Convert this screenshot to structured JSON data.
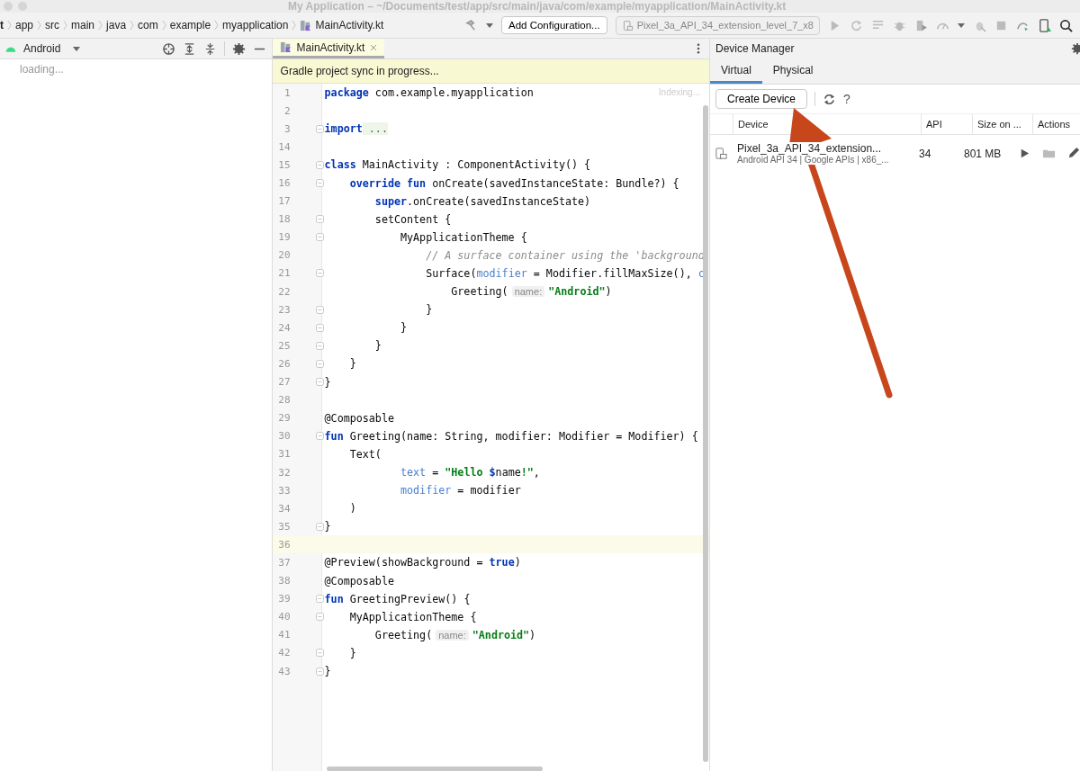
{
  "window": {
    "title": "My Application – ~/Documents/test/app/src/main/java/com/example/myapplication/MainActivity.kt"
  },
  "breadcrumbs": [
    {
      "label": "t",
      "kind": "folder"
    },
    {
      "label": "app",
      "kind": "folder"
    },
    {
      "label": "src",
      "kind": "folder"
    },
    {
      "label": "main",
      "kind": "folder"
    },
    {
      "label": "java",
      "kind": "folder"
    },
    {
      "label": "com",
      "kind": "folder"
    },
    {
      "label": "example",
      "kind": "folder"
    },
    {
      "label": "myapplication",
      "kind": "folder"
    },
    {
      "label": "MainActivity.kt",
      "kind": "file"
    }
  ],
  "toolbar": {
    "config_button": "Add Configuration...",
    "device_selector": "Pixel_3a_API_34_extension_level_7_x8"
  },
  "project_panel": {
    "view": "Android",
    "status": "loading..."
  },
  "editor": {
    "tabs": [
      {
        "label": "MainActivity.kt",
        "selected": true
      }
    ],
    "banner": "Gradle project sync in progress...",
    "indexing": "Indexing...",
    "lines": [
      {
        "number": "1",
        "tokens": [
          {
            "kind": "kw",
            "text": "package"
          },
          {
            "kind": "plain",
            "text": " com.example.myapplication"
          }
        ]
      },
      {
        "number": "2"
      },
      {
        "number": "3",
        "fold": true,
        "tokens": [
          {
            "kind": "kw",
            "text": "import"
          },
          {
            "kind": "folded",
            "text": " ..."
          }
        ]
      },
      {
        "number": "14"
      },
      {
        "number": "15",
        "fold": true,
        "tokens": [
          {
            "kind": "kw",
            "text": "class"
          },
          {
            "kind": "plain",
            "text": " MainActivity : ComponentActivity() {"
          }
        ]
      },
      {
        "number": "16",
        "fold": true,
        "tokens": [
          {
            "kind": "kw",
            "text": "    override fun"
          },
          {
            "kind": "plain",
            "text": " onCreate(savedInstanceState: Bundle?) {"
          }
        ]
      },
      {
        "number": "17",
        "tokens": [
          {
            "kind": "kw",
            "text": "        super"
          },
          {
            "kind": "plain",
            "text": ".onCreate(savedInstanceState)"
          }
        ]
      },
      {
        "number": "18",
        "fold": true,
        "tokens": [
          {
            "kind": "plain",
            "text": "        setContent {"
          }
        ]
      },
      {
        "number": "19",
        "fold": true,
        "tokens": [
          {
            "kind": "plain",
            "text": "            MyApplicationTheme {"
          }
        ]
      },
      {
        "number": "20",
        "tokens": [
          {
            "kind": "comment",
            "text": "                // A surface container using the 'background"
          }
        ]
      },
      {
        "number": "21",
        "fold": true,
        "tokens": [
          {
            "kind": "plain",
            "text": "                Surface("
          },
          {
            "kind": "param",
            "text": "modifier"
          },
          {
            "kind": "plain",
            "text": " = Modifier.fillMaxSize(), "
          },
          {
            "kind": "param",
            "text": "c"
          }
        ]
      },
      {
        "number": "22",
        "tokens": [
          {
            "kind": "plain",
            "text": "                    Greeting("
          },
          {
            "kind": "hint",
            "text": "name:"
          },
          {
            "kind": "string",
            "text": "\"Android\""
          },
          {
            "kind": "plain",
            "text": ")"
          }
        ]
      },
      {
        "number": "23",
        "fold": true,
        "tokens": [
          {
            "kind": "plain",
            "text": "                }"
          }
        ]
      },
      {
        "number": "24",
        "fold": true,
        "tokens": [
          {
            "kind": "plain",
            "text": "            }"
          }
        ]
      },
      {
        "number": "25",
        "fold": true,
        "tokens": [
          {
            "kind": "plain",
            "text": "        }"
          }
        ]
      },
      {
        "number": "26",
        "fold": true,
        "tokens": [
          {
            "kind": "plain",
            "text": "    }"
          }
        ]
      },
      {
        "number": "27",
        "fold": true,
        "tokens": [
          {
            "kind": "plain",
            "text": "}"
          }
        ]
      },
      {
        "number": "28"
      },
      {
        "number": "29",
        "tokens": [
          {
            "kind": "plain",
            "text": "@Composable"
          }
        ]
      },
      {
        "number": "30",
        "fold": true,
        "tokens": [
          {
            "kind": "kw",
            "text": "fun"
          },
          {
            "kind": "plain",
            "text": " Greeting(name: String, modifier: Modifier = Modifier) {"
          }
        ]
      },
      {
        "number": "31",
        "tokens": [
          {
            "kind": "plain",
            "text": "    Text("
          }
        ]
      },
      {
        "number": "32",
        "tokens": [
          {
            "kind": "param",
            "text": "            text"
          },
          {
            "kind": "plain",
            "text": " = "
          },
          {
            "kind": "string",
            "text": "\"Hello "
          },
          {
            "kind": "kw",
            "text": "$"
          },
          {
            "kind": "plain",
            "text": "name"
          },
          {
            "kind": "string",
            "text": "!\""
          },
          {
            "kind": "plain",
            "text": ","
          }
        ]
      },
      {
        "number": "33",
        "tokens": [
          {
            "kind": "param",
            "text": "            modifier"
          },
          {
            "kind": "plain",
            "text": " = modifier"
          }
        ]
      },
      {
        "number": "34",
        "tokens": [
          {
            "kind": "plain",
            "text": "    )"
          }
        ]
      },
      {
        "number": "35",
        "fold": true,
        "tokens": [
          {
            "kind": "plain",
            "text": "}"
          }
        ]
      },
      {
        "number": "36",
        "current": true
      },
      {
        "number": "37",
        "tokens": [
          {
            "kind": "plain",
            "text": "@Preview(showBackground = "
          },
          {
            "kind": "kw",
            "text": "true"
          },
          {
            "kind": "plain",
            "text": ")"
          }
        ]
      },
      {
        "number": "38",
        "tokens": [
          {
            "kind": "plain",
            "text": "@Composable"
          }
        ]
      },
      {
        "number": "39",
        "fold": true,
        "tokens": [
          {
            "kind": "kw",
            "text": "fun"
          },
          {
            "kind": "plain",
            "text": " GreetingPreview() {"
          }
        ]
      },
      {
        "number": "40",
        "fold": true,
        "tokens": [
          {
            "kind": "plain",
            "text": "    MyApplicationTheme {"
          }
        ]
      },
      {
        "number": "41",
        "tokens": [
          {
            "kind": "plain",
            "text": "        Greeting("
          },
          {
            "kind": "hint",
            "text": "name:"
          },
          {
            "kind": "string",
            "text": "\"Android\""
          },
          {
            "kind": "plain",
            "text": ")"
          }
        ]
      },
      {
        "number": "42",
        "fold": true,
        "tokens": [
          {
            "kind": "plain",
            "text": "    }"
          }
        ]
      },
      {
        "number": "43",
        "fold": true,
        "tokens": [
          {
            "kind": "plain",
            "text": "}"
          }
        ]
      }
    ]
  },
  "device_manager": {
    "title": "Device Manager",
    "tabs": [
      {
        "label": "Virtual",
        "selected": true
      },
      {
        "label": "Physical",
        "selected": false
      }
    ],
    "create_button": "Create Device",
    "help": "?",
    "columns": [
      "Device",
      "API",
      "Size on ...",
      "Actions"
    ],
    "devices": [
      {
        "name": "Pixel_3a_API_34_extension...",
        "details": "Android API 34 | Google APIs | x86_...",
        "api": "34",
        "size": "801 MB"
      }
    ]
  }
}
